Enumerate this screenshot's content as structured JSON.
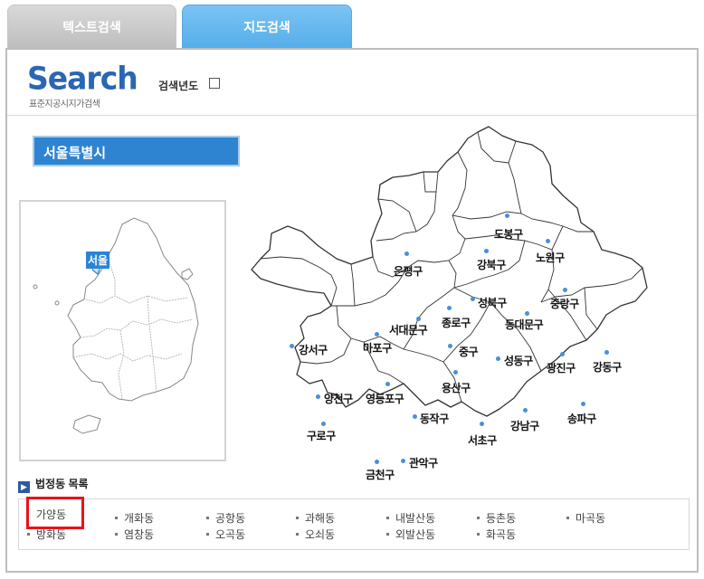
{
  "tabs": [
    {
      "label": "텍스트검색"
    },
    {
      "label": "지도검색"
    }
  ],
  "header": {
    "logo_word": "Search",
    "logo_sub": "표준지공시지가검색",
    "year_label": "검색년도",
    "year_checked": false
  },
  "city": {
    "label": "서울특별시"
  },
  "korea_map": {
    "selected_label": "서울"
  },
  "districts": [
    {
      "name": "도봉구"
    },
    {
      "name": "노원구"
    },
    {
      "name": "강북구"
    },
    {
      "name": "은평구"
    },
    {
      "name": "성북구"
    },
    {
      "name": "중랑구"
    },
    {
      "name": "종로구"
    },
    {
      "name": "서대문구"
    },
    {
      "name": "동대문구"
    },
    {
      "name": "마포구"
    },
    {
      "name": "강서구"
    },
    {
      "name": "중구"
    },
    {
      "name": "성동구"
    },
    {
      "name": "광진구"
    },
    {
      "name": "강동구"
    },
    {
      "name": "양천구"
    },
    {
      "name": "영등포구"
    },
    {
      "name": "용산구"
    },
    {
      "name": "동작구"
    },
    {
      "name": "송파구"
    },
    {
      "name": "강남구"
    },
    {
      "name": "구로구"
    },
    {
      "name": "서초구"
    },
    {
      "name": "관악구"
    },
    {
      "name": "금천구"
    }
  ],
  "dong_list": {
    "title": "법정동 목록",
    "items": [
      {
        "label": "가양동"
      },
      {
        "label": "개화동"
      },
      {
        "label": "공항동"
      },
      {
        "label": "과해동"
      },
      {
        "label": "내발산동"
      },
      {
        "label": "등촌동"
      },
      {
        "label": "마곡동"
      },
      {
        "label": "방화동"
      },
      {
        "label": "염창동"
      },
      {
        "label": "오곡동"
      },
      {
        "label": "오쇠동"
      },
      {
        "label": "외발산동"
      },
      {
        "label": "화곡동"
      }
    ]
  },
  "colors": {
    "accent": "#2e84d0",
    "tab_active": "#54aeea",
    "highlight": "#e8131a",
    "dot": "#4a8fd8"
  }
}
